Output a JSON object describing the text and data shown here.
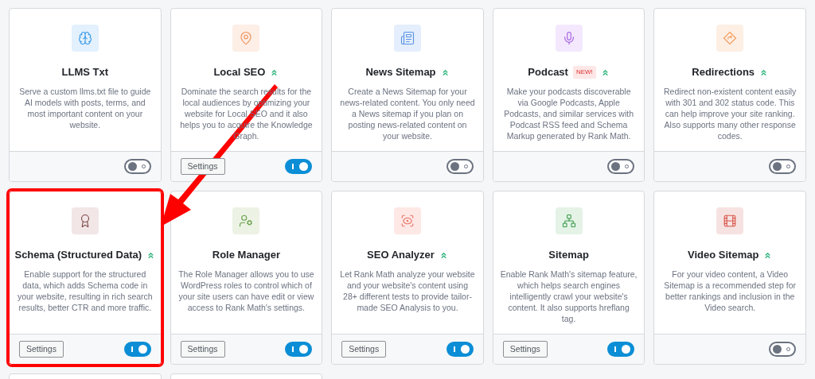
{
  "modules": [
    {
      "title": "LLMS Txt",
      "pro": false,
      "description": "Serve a custom llms.txt file to guide AI models with posts, terms, and most important content on your website.",
      "on": false,
      "highlighted": false
    },
    {
      "title": "Local SEO",
      "pro": true,
      "description": "Dominate the search results for the local audiences by optimizing your website for Local SEO and it also helps you to acquire the Knowledge Graph.",
      "settings": "Settings",
      "on": true,
      "highlighted": false
    },
    {
      "title": "News Sitemap",
      "pro": true,
      "description": "Create a News Sitemap for your news-related content. You only need a News sitemap if you plan on posting news-related content on your website.",
      "on": false,
      "highlighted": false
    },
    {
      "title": "Podcast",
      "badge": "NEW!",
      "pro": true,
      "description": "Make your podcasts discoverable via Google Podcasts, Apple Podcasts, and similar services with Podcast RSS feed and Schema Markup generated by Rank Math.",
      "on": false,
      "highlighted": false
    },
    {
      "title": "Redirections",
      "pro": true,
      "description": "Redirect non-existent content easily with 301 and 302 status code. This can help improve your site ranking. Also supports many other response codes.",
      "on": false,
      "highlighted": false
    },
    {
      "title": "Schema (Structured Data)",
      "pro": true,
      "description": "Enable support for the structured data, which adds Schema code in your website, resulting in rich search results, better CTR and more traffic.",
      "settings": "Settings",
      "on": true,
      "highlighted": true
    },
    {
      "title": "Role Manager",
      "pro": false,
      "description": "The Role Manager allows you to use WordPress roles to control which of your site users can have edit or view access to Rank Math's settings.",
      "settings": "Settings",
      "on": true,
      "highlighted": false
    },
    {
      "title": "SEO Analyzer",
      "pro": true,
      "description": "Let Rank Math analyze your website and your website's content using 28+ different tests to provide tailor-made SEO Analysis to you.",
      "settings": "Settings",
      "on": true,
      "highlighted": false
    },
    {
      "title": "Sitemap",
      "pro": false,
      "description": "Enable Rank Math's sitemap feature, which helps search engines intelligently crawl your website's content. It also supports hreflang tag.",
      "settings": "Settings",
      "on": true,
      "highlighted": false
    },
    {
      "title": "Video Sitemap",
      "pro": true,
      "description": "For your video content, a Video Sitemap is a recommended step for better rankings and inclusion in the Video search.",
      "on": false,
      "highlighted": false
    }
  ],
  "more_cards": [
    {
      "kind": "card"
    },
    {
      "kind": "card"
    }
  ]
}
